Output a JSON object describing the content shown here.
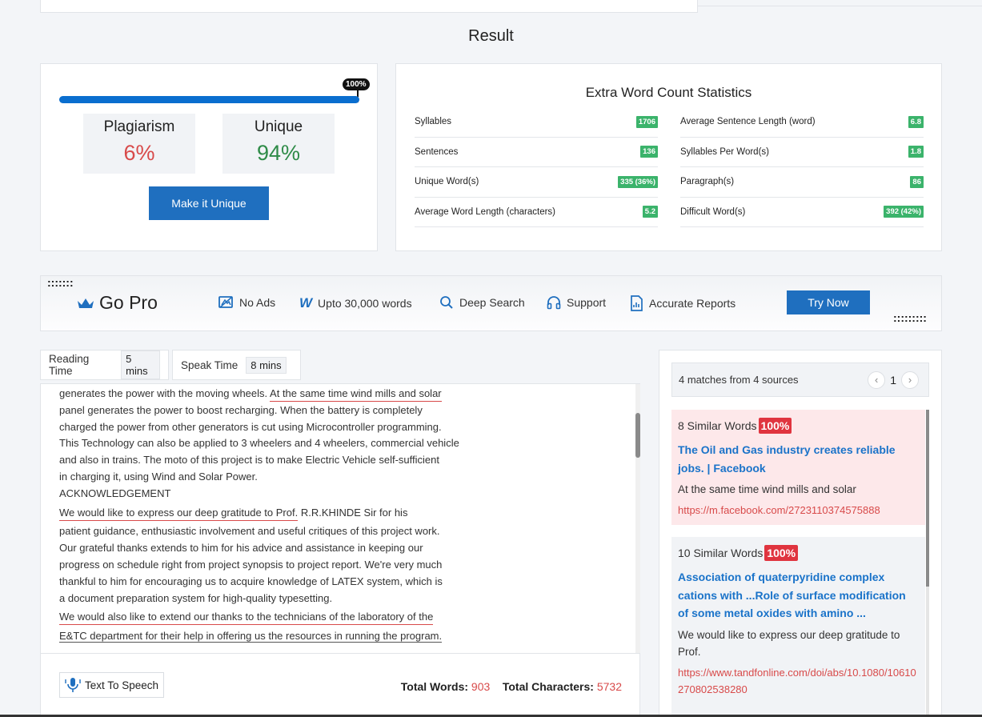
{
  "result": {
    "title": "Result",
    "progress_label": "100%",
    "progress_value": 1.0,
    "plagiarism_label": "Plagiarism",
    "plagiarism_value": "6%",
    "unique_label": "Unique",
    "unique_value": "94%",
    "make_unique_label": "Make it Unique"
  },
  "stats": {
    "title": "Extra Word Count Statistics",
    "left": [
      {
        "label": "Syllables",
        "value": "1706"
      },
      {
        "label": "Sentences",
        "value": "136"
      },
      {
        "label": "Unique Word(s)",
        "value": "335 (36%)"
      },
      {
        "label": "Average Word Length (characters)",
        "value": "5.2"
      }
    ],
    "right": [
      {
        "label": "Average Sentence Length (word)",
        "value": "6.8"
      },
      {
        "label": "Syllables Per Word(s)",
        "value": "1.8"
      },
      {
        "label": "Paragraph(s)",
        "value": "86"
      },
      {
        "label": "Difficult Word(s)",
        "value": "392 (42%)"
      }
    ]
  },
  "gopro": {
    "title": "Go Pro",
    "features": [
      "No Ads",
      "Upto 30,000 words",
      "Deep Search",
      "Support",
      "Accurate Reports"
    ],
    "try_now_label": "Try Now"
  },
  "times": {
    "reading_label": "Reading Time",
    "reading_value": "5 mins",
    "speak_label": "Speak Time",
    "speak_value": "8 mins"
  },
  "text": {
    "lines": [
      "generates the power with the moving wheels. ",
      "At the same time wind mills and solar",
      "panel generates the power to boost recharging. When the battery is completely",
      "charged the power from other generators is cut using Microcontroller programming.",
      "This Technology can also be applied to 3 wheelers and 4 wheelers, commercial vehicle",
      "and also in trains. The moto of this project is to make Electric Vehicle self-sufficient",
      "in charging it, using Wind and Solar Power.",
      "ACKNOWLEDGEMENT",
      "We would like to express our deep gratitude to Prof.",
      " R.R.KHINDE Sir for his",
      "patient guidance, enthusiastic involvement and useful critiques of this project work.",
      "Our grateful thanks extends to him for his advice and assistance in keeping our",
      "progress on schedule right from project synopsis to project report. We're very much",
      "thankful to him for encouraging us to acquire knowledge of LATEX system, which is",
      "a document preparation system for high-quality typesetting.",
      "We would also like to extend our thanks to the technicians of the laboratory of the",
      "E&TC department for their help in offering us the resources in running the program."
    ],
    "tts_label": "Text To Speech",
    "total_words_label": "Total Words:",
    "total_words_value": "903",
    "total_chars_label": "Total Characters:",
    "total_chars_value": "5732"
  },
  "sources": {
    "summary": "4 matches from 4 sources",
    "page": "1",
    "items": [
      {
        "similar": "8 Similar Words",
        "percent": "100%",
        "title": "The Oil and Gas industry creates reliable jobs. | Facebook",
        "snippet": "At the same time wind mills and solar",
        "url": "https://m.facebook.com/2723110374575888"
      },
      {
        "similar": "10 Similar Words",
        "percent": "100%",
        "title": "Association of quaterpyridine complex cations with ...Role of surface modification of some metal oxides with amino ...",
        "snippet": "We would like to express our deep gratitude to Prof.",
        "url": "https://www.tandfonline.com/doi/abs/10.1080/10610270802538280"
      }
    ]
  },
  "colors": {
    "accent": "#1f6fbf",
    "plagiarism": "#d84a4a",
    "unique": "#2e8b47",
    "badge_green": "#3bb36b",
    "badge_red": "#e0343f"
  }
}
